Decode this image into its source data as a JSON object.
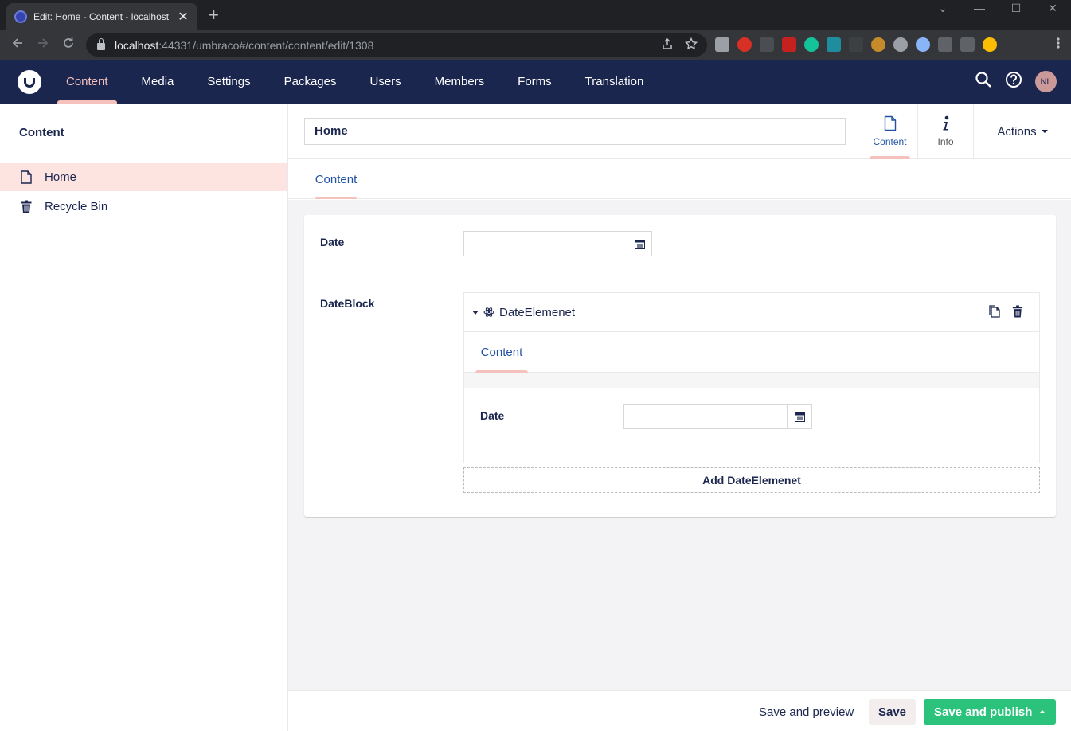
{
  "browser": {
    "tab_title": "Edit: Home - Content - localhost",
    "tab_close": "✕",
    "new_tab": "+",
    "url_host": "localhost",
    "url_rest": ":44331/umbraco#/content/content/edit/1308",
    "window_controls": [
      "⌄",
      "—",
      "☐",
      "✕"
    ]
  },
  "header": {
    "sections": [
      "Content",
      "Media",
      "Settings",
      "Packages",
      "Users",
      "Members",
      "Forms",
      "Translation"
    ],
    "active_section": "Content",
    "avatar_initials": "NL"
  },
  "tree": {
    "title": "Content",
    "items": [
      {
        "label": "Home",
        "icon": "document-icon",
        "active": true
      },
      {
        "label": "Recycle Bin",
        "icon": "trash-icon",
        "active": false
      }
    ]
  },
  "editor": {
    "name_value": "Home",
    "apps": [
      {
        "label": "Content",
        "icon": "document-icon",
        "active": true
      },
      {
        "label": "Info",
        "icon": "info-icon",
        "active": false
      }
    ],
    "actions_label": "Actions",
    "tab": "Content",
    "properties": {
      "date_label": "Date",
      "date_value": "",
      "block_label": "DateBlock",
      "block_title": "DateElemenet",
      "block_tab": "Content",
      "block_date_label": "Date",
      "block_date_value": "",
      "add_label": "Add DateElemenet"
    }
  },
  "footer": {
    "preview_label": "Save and preview",
    "save_label": "Save",
    "publish_label": "Save and publish"
  },
  "colors": {
    "header_bg": "#1b264f",
    "accent": "#f5c1bc",
    "link_blue": "#2152a3",
    "publish_green": "#2bc37c"
  }
}
